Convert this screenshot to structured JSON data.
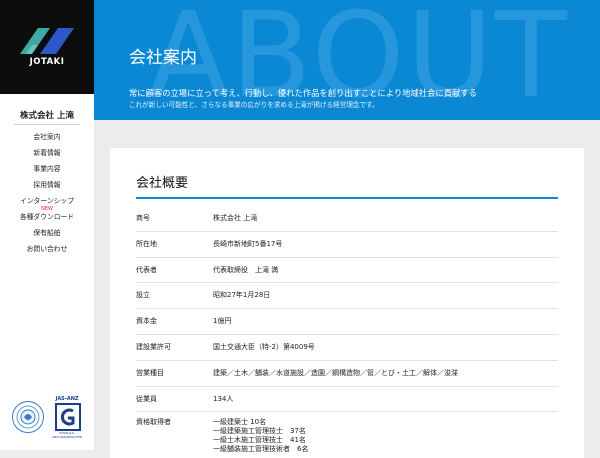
{
  "brand": {
    "logo_text": "JOTAKI",
    "company_name": "株式会社 上滝"
  },
  "nav": {
    "items": [
      "会社案内",
      "新着情報",
      "事業内容",
      "採用情報",
      "インターンシップ",
      "各種ダウンロード",
      "保有船舶",
      "お問い合わせ"
    ],
    "new_badge": "NEW"
  },
  "certs": {
    "anz_label": "JAS-ANZ",
    "anz_foot": "WWW.JAS-ANZ.ORG/REGISTER"
  },
  "hero": {
    "bg_text": "ABOUT",
    "title": "会社案内",
    "line1": "常に顧客の立場に立って考え、行動し、優れた作品を創り出すことにより地域社会に貢献する",
    "line2": "これが新しい可能性と、さらなる事業の広がりを求める上滝が掲げる経営理念です。"
  },
  "overview": {
    "title": "会社概要",
    "rows": [
      {
        "label": "商号",
        "value": "株式会社 上滝"
      },
      {
        "label": "所在地",
        "value": "長崎市新地町5番17号"
      },
      {
        "label": "代表者",
        "value": "代表取締役　上滝 満"
      },
      {
        "label": "設立",
        "value": "昭和27年1月28日"
      },
      {
        "label": "資本金",
        "value": "1億円"
      },
      {
        "label": "建設業許可",
        "value": "国土交通大臣（特-2）第4009号"
      },
      {
        "label": "営業種目",
        "value": "建築／土木／舗装／水道施設／造園／鋼構造物／管／とび・土工／解体／浚渫"
      },
      {
        "label": "従業員",
        "value": "134人"
      }
    ],
    "qualifications": {
      "label": "資格取得者",
      "items": [
        "一級建築士 10名",
        "一級建築施工管理技士　37名",
        "一級土木施工管理技士　41名",
        "一級舗装施工管理技術者　6名"
      ]
    }
  },
  "colors": {
    "accent": "#0b88d4",
    "sidebar_logo_bg": "#0d0d0d",
    "new_badge": "#e02a2a"
  }
}
